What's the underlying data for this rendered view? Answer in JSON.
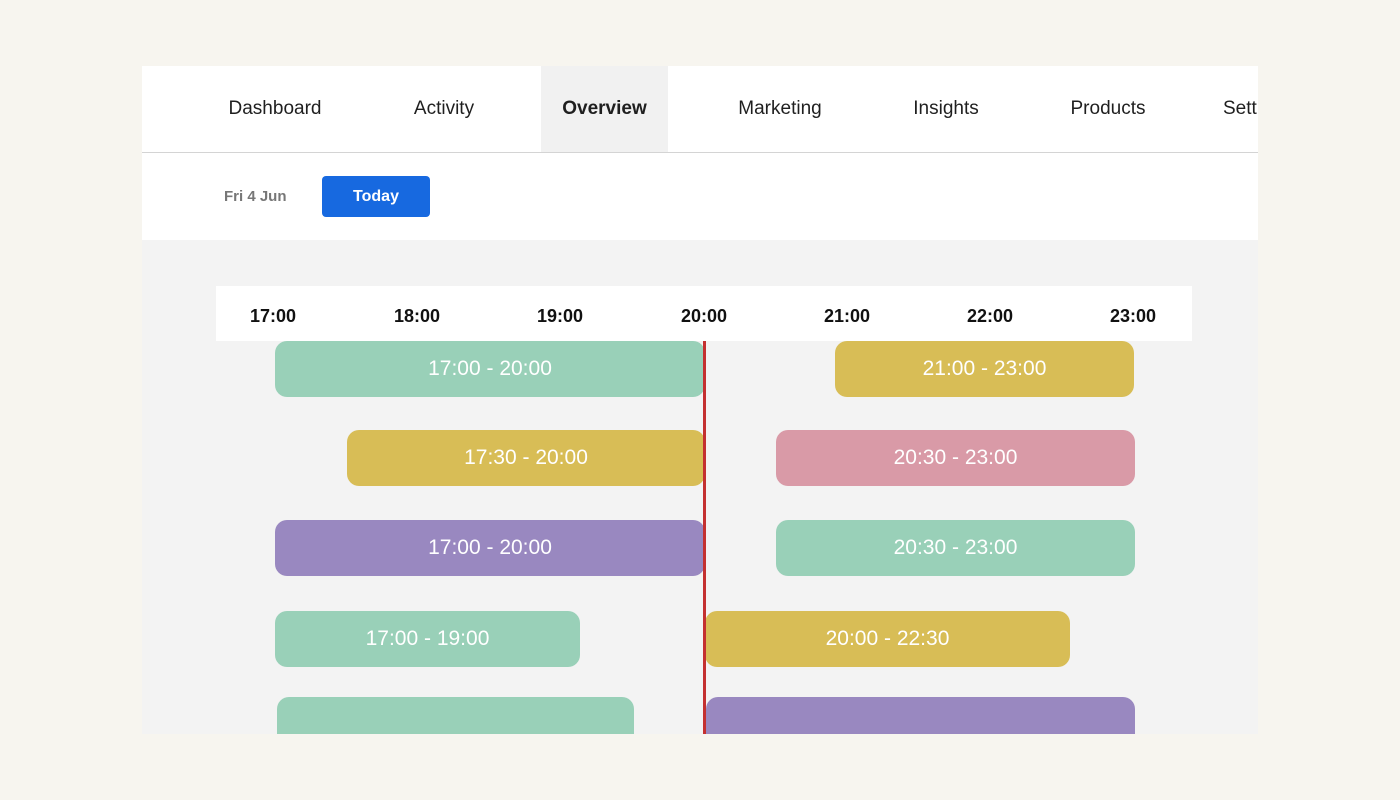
{
  "nav": {
    "tabs": [
      {
        "label": "Dashboard",
        "active": false
      },
      {
        "label": "Activity",
        "active": false
      },
      {
        "label": "Overview",
        "active": true
      },
      {
        "label": "Marketing",
        "active": false
      },
      {
        "label": "Insights",
        "active": false
      },
      {
        "label": "Products",
        "active": false
      },
      {
        "label": "Sett",
        "active": false
      }
    ]
  },
  "toolbar": {
    "date": "Fri 4 Jun",
    "today_label": "Today",
    "today_color": "#1769e0"
  },
  "timeline": {
    "hours": [
      "17:00",
      "18:00",
      "19:00",
      "20:00",
      "21:00",
      "22:00",
      "23:00"
    ],
    "current_time": "20:00",
    "now_line_color": "#c43030",
    "events": [
      {
        "label": "17:00 - 20:00",
        "color": "#99d0b8"
      },
      {
        "label": "21:00 - 23:00",
        "color": "#d8bd56"
      },
      {
        "label": "17:30 - 20:00",
        "color": "#d8bd56"
      },
      {
        "label": "20:30 - 23:00",
        "color": "#d99aa7"
      },
      {
        "label": "17:00 - 20:00",
        "color": "#9988c0"
      },
      {
        "label": "20:30 - 23:00",
        "color": "#99d0b8"
      },
      {
        "label": "17:00 - 19:00",
        "color": "#99d0b8"
      },
      {
        "label": "20:00 - 22:30",
        "color": "#d8bd56"
      },
      {
        "label": "",
        "color": "#99d0b8"
      },
      {
        "label": "",
        "color": "#9988c0"
      }
    ]
  }
}
